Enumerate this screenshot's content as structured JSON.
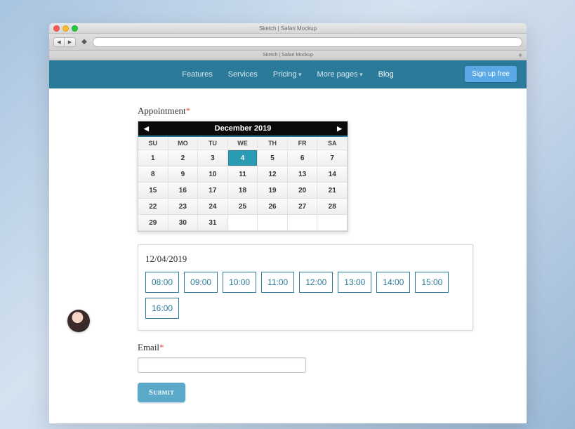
{
  "browser": {
    "title": "Sketch | Safari Mockup",
    "tab_title": "Sketch | Safari Mockup"
  },
  "header": {
    "nav": {
      "features": "Features",
      "services": "Services",
      "pricing": "Pricing",
      "more_pages": "More pages",
      "blog": "Blog"
    },
    "signup": "Sign up free"
  },
  "form": {
    "appointment_label": "Appointment",
    "required_mark": "*",
    "email_label": "Email",
    "submit": "Submit"
  },
  "calendar": {
    "month_label": "December 2019",
    "dow": [
      "SU",
      "MO",
      "TU",
      "WE",
      "TH",
      "FR",
      "SA"
    ],
    "weeks": [
      [
        1,
        2,
        3,
        4,
        5,
        6,
        7
      ],
      [
        8,
        9,
        10,
        11,
        12,
        13,
        14
      ],
      [
        15,
        16,
        17,
        18,
        19,
        20,
        21
      ],
      [
        22,
        23,
        24,
        25,
        26,
        27,
        28
      ],
      [
        29,
        30,
        31,
        null,
        null,
        null,
        null
      ]
    ],
    "selected_day": 4
  },
  "slots": {
    "date_label": "12/04/2019",
    "times": [
      "08:00",
      "09:00",
      "10:00",
      "11:00",
      "12:00",
      "13:00",
      "14:00",
      "15:00",
      "16:00"
    ]
  },
  "email_value": ""
}
